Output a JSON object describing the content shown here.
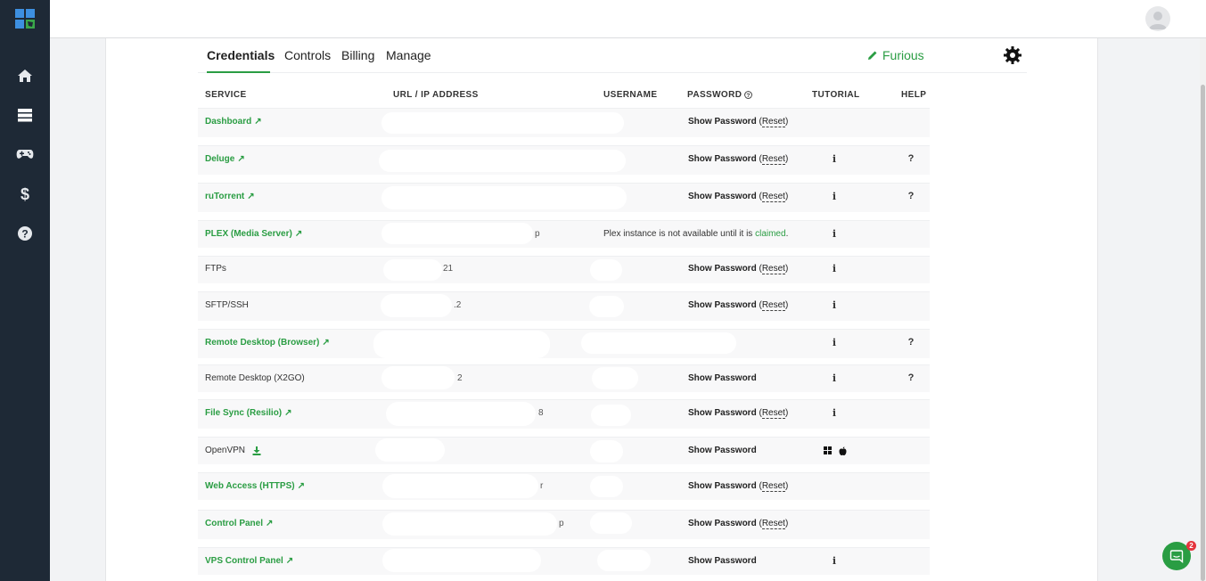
{
  "tabs": [
    {
      "label": "Credentials"
    },
    {
      "label": "Controls"
    },
    {
      "label": "Billing"
    },
    {
      "label": "Manage"
    }
  ],
  "server_name": "Furious",
  "columns": {
    "service": "SERVICE",
    "url": "URL / IP ADDRESS",
    "username": "USERNAME",
    "password": "PASSWORD",
    "tutorial": "TUTORIAL",
    "help": "HELP"
  },
  "rows": [
    {
      "service": "Dashboard",
      "password": "Show Password",
      "reset": "Reset"
    },
    {
      "service": "Deluge",
      "password": "Show Password",
      "reset": "Reset",
      "tutorial": "i",
      "help": "?"
    },
    {
      "service": "ruTorrent",
      "password": "Show Password",
      "reset": "Reset",
      "tutorial": "i",
      "help": "?"
    },
    {
      "service": "PLEX (Media Server)",
      "url_fragment": "p",
      "message": "Plex instance is not available until it is ",
      "message_link": "claimed",
      "message_end": ".",
      "tutorial": "i"
    },
    {
      "service": "FTPs",
      "url_fragment": "21",
      "password": "Show Password",
      "reset": "Reset",
      "tutorial": "i"
    },
    {
      "service": "SFTP/SSH",
      "url_fragment": ".2",
      "password": "Show Password",
      "reset": "Reset",
      "tutorial": "i"
    },
    {
      "service": "Remote Desktop (Browser)",
      "url_fragment": "",
      "tutorial": "i",
      "help": "?"
    },
    {
      "service": "Remote Desktop (X2GO)",
      "url_fragment": "2",
      "password": "Show Password",
      "tutorial": "i",
      "help": "?"
    },
    {
      "service": "File Sync (Resilio)",
      "url_fragment": "8",
      "password": "Show Password",
      "reset": "Reset",
      "tutorial": "i"
    },
    {
      "service": "OpenVPN",
      "password": "Show Password"
    },
    {
      "service": "Web Access (HTTPS)",
      "url_fragment": "r",
      "password": "Show Password",
      "reset": "Reset"
    },
    {
      "service": "Control Panel",
      "url_fragment": "p",
      "password": "Show Password",
      "reset": "Reset"
    },
    {
      "service": "VPS Control Panel",
      "url_fragment": "",
      "password": "Show Password",
      "tutorial": "i"
    }
  ],
  "chat_badge": "2",
  "colors": {
    "accent": "#2a9d43",
    "sidebar": "#1e2936",
    "badge": "#e5343d"
  }
}
